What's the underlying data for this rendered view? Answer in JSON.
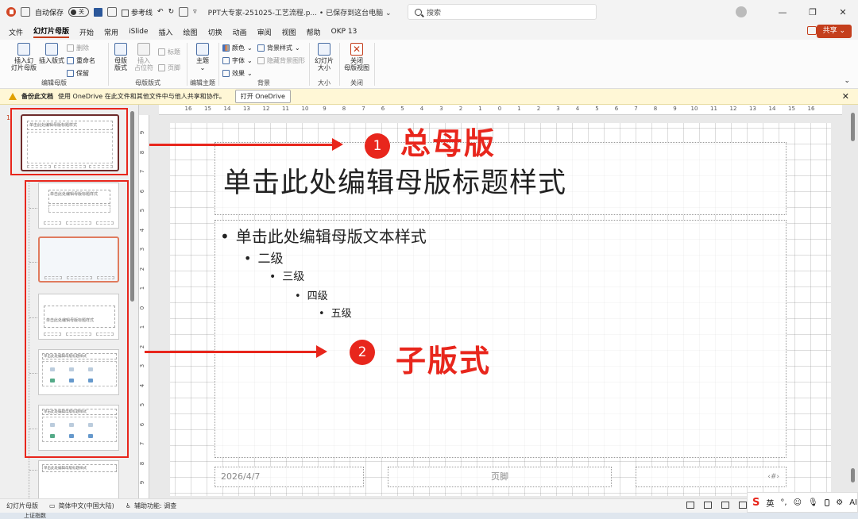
{
  "titlebar": {
    "autosave_label": "自动保存",
    "autosave_state": "关",
    "reference_label": "参考线",
    "doc_title": "PPT大专家-251025-工艺流程.p...",
    "save_status": "• 已保存到这台电脑",
    "search_placeholder": "搜索"
  },
  "menu": {
    "items": [
      "文件",
      "幻灯片母版",
      "开始",
      "常用",
      "iSlide",
      "插入",
      "绘图",
      "切换",
      "动画",
      "审阅",
      "视图",
      "帮助",
      "OKP 13"
    ],
    "active": "幻灯片母版",
    "share_label": "共享"
  },
  "ribbon": {
    "groups": {
      "edit_master": "编辑母版",
      "master_layout": "母版版式",
      "edit_theme": "编辑主题",
      "background": "背景",
      "size": "大小",
      "close": "关闭"
    },
    "buttons": {
      "insert_master": "插入幻\n灯片母版",
      "insert_layout": "插入版式",
      "delete": "删除",
      "rename": "重命名",
      "preserve": "保留",
      "master_layout": "母版\n版式",
      "insert_placeholder": "插入\n占位符",
      "title_chk": "标题",
      "footer_chk": "页脚",
      "theme": "主题",
      "colors": "颜色",
      "fonts": "字体",
      "effects": "效果",
      "bg_styles": "背景样式",
      "hide_bg": "隐藏背景图形",
      "slide_size": "幻灯片\n大小",
      "close_master": "关闭\n母版视图"
    }
  },
  "notify": {
    "title": "备份此文档",
    "message": "使用 OneDrive 在此文件和其他文件中与他人共享和协作。",
    "button": "打开 OneDrive"
  },
  "thumbs": {
    "slide_number": "1",
    "master_title": "单击此处编辑母版标题样式",
    "layout_titles": [
      "单击此处编辑母版标题样式",
      "",
      "单击此处编辑母版标题样式",
      "单击此处编辑母版标题样式",
      "单击此处编辑母版标题样式",
      "单击此处编辑母版标题样式"
    ]
  },
  "ruler": {
    "h": [
      "16",
      "15",
      "14",
      "13",
      "12",
      "11",
      "10",
      "9",
      "8",
      "7",
      "6",
      "5",
      "4",
      "3",
      "2",
      "1",
      "0",
      "1",
      "2",
      "3",
      "4",
      "5",
      "6",
      "7",
      "8",
      "9",
      "10",
      "11",
      "12",
      "13",
      "14",
      "15",
      "16"
    ],
    "v": [
      "9",
      "8",
      "7",
      "6",
      "5",
      "4",
      "3",
      "2",
      "1",
      "0",
      "1",
      "2",
      "3",
      "4",
      "5",
      "6",
      "7",
      "8",
      "9"
    ]
  },
  "slide": {
    "title": "单击此处编辑母版标题样式",
    "level1": "单击此处编辑母版文本样式",
    "level2": "二级",
    "level3": "三级",
    "level4": "四级",
    "level5": "五级",
    "date": "2026/4/7",
    "footer": "页脚",
    "number": "‹#›"
  },
  "annotations": {
    "badge1": "1",
    "label1": "总母版",
    "badge2": "2",
    "label2": "子版式"
  },
  "status": {
    "view": "幻灯片母版",
    "lang": "简体中文(中国大陆)",
    "accessibility": "辅助功能: 调查",
    "ime_lang": "英",
    "taskbar_text": "上证指数"
  },
  "colors": {
    "accent": "#c43e1c",
    "annotation_red": "#e8261c"
  }
}
